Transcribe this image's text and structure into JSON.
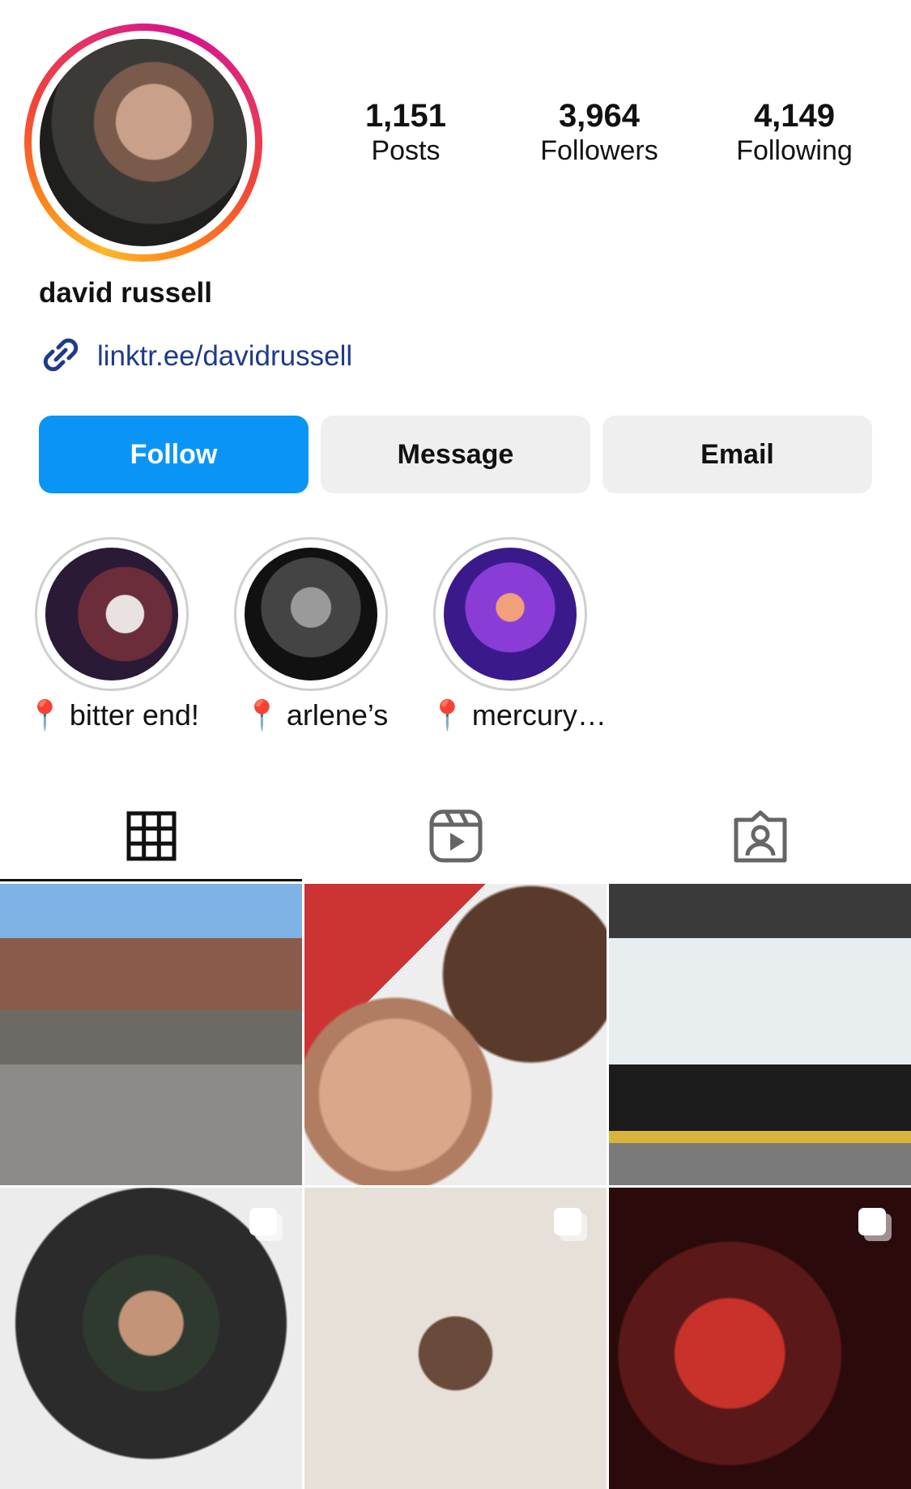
{
  "profile": {
    "name": "david russell",
    "link": "linktr.ee/davidrussell"
  },
  "stats": [
    {
      "value": "1,151",
      "label": "Posts"
    },
    {
      "value": "3,964",
      "label": "Followers"
    },
    {
      "value": "4,149",
      "label": "Following"
    }
  ],
  "actions": {
    "follow": "Follow",
    "message": "Message",
    "email": "Email"
  },
  "highlights": [
    {
      "label": "bitter end!",
      "pin": "📍"
    },
    {
      "label": "arlene’s",
      "pin": "📍"
    },
    {
      "label": "mercury…",
      "pin": "📍"
    }
  ],
  "tabs": [
    {
      "icon": "grid-icon",
      "active": true
    },
    {
      "icon": "reels-icon",
      "active": false
    },
    {
      "icon": "tagged-icon",
      "active": false
    }
  ],
  "colors": {
    "follow_button": "#0a95f6",
    "secondary_button": "#efefef",
    "link": "#1e3a8a"
  }
}
